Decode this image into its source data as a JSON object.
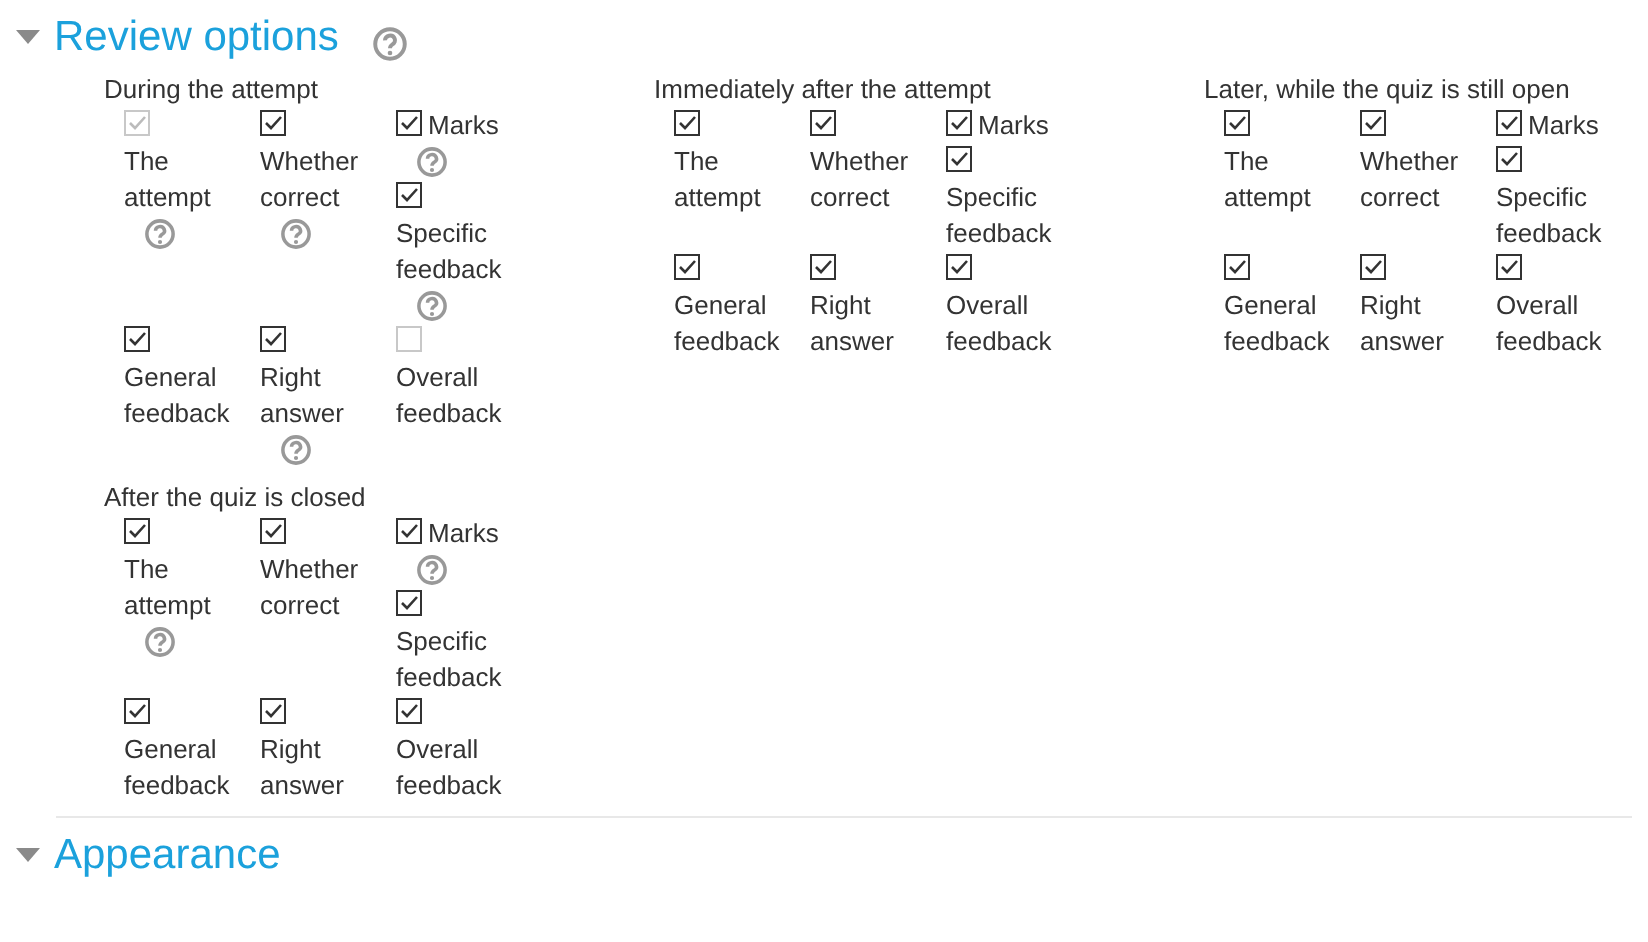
{
  "sections": [
    {
      "title": "Review options",
      "expanded": true,
      "help": true,
      "groups": [
        {
          "title": "During the attempt",
          "items": [
            {
              "label": "The attempt",
              "checked": true,
              "disabled": true,
              "help": true
            },
            {
              "label": "Whether correct",
              "checked": true,
              "disabled": false,
              "help": true
            },
            {
              "label": "Marks",
              "checked": true,
              "disabled": false,
              "help": true
            },
            {
              "label": "Specific feedback",
              "checked": true,
              "disabled": false,
              "help": true
            },
            {
              "label": "General feedback",
              "checked": true,
              "disabled": false,
              "help": false
            },
            {
              "label": "Right answer",
              "checked": true,
              "disabled": false,
              "help": true
            },
            {
              "label": "Overall feedback",
              "checked": false,
              "disabled": true,
              "help": false
            }
          ]
        },
        {
          "title": "Immediately after the attempt",
          "items": [
            {
              "label": "The attempt",
              "checked": true,
              "disabled": false,
              "help": false
            },
            {
              "label": "Whether correct",
              "checked": true,
              "disabled": false,
              "help": false
            },
            {
              "label": "Marks",
              "checked": true,
              "disabled": false,
              "help": false
            },
            {
              "label": "Specific feedback",
              "checked": true,
              "disabled": false,
              "help": false
            },
            {
              "label": "General feedback",
              "checked": true,
              "disabled": false,
              "help": false
            },
            {
              "label": "Right answer",
              "checked": true,
              "disabled": false,
              "help": false
            },
            {
              "label": "Overall feedback",
              "checked": true,
              "disabled": false,
              "help": false
            }
          ]
        },
        {
          "title": "Later, while the quiz is still open",
          "items": [
            {
              "label": "The attempt",
              "checked": true,
              "disabled": false,
              "help": false
            },
            {
              "label": "Whether correct",
              "checked": true,
              "disabled": false,
              "help": false
            },
            {
              "label": "Marks",
              "checked": true,
              "disabled": false,
              "help": false
            },
            {
              "label": "Specific feedback",
              "checked": true,
              "disabled": false,
              "help": false
            },
            {
              "label": "General feedback",
              "checked": true,
              "disabled": false,
              "help": false
            },
            {
              "label": "Right answer",
              "checked": true,
              "disabled": false,
              "help": false
            },
            {
              "label": "Overall feedback",
              "checked": true,
              "disabled": false,
              "help": false
            }
          ]
        },
        {
          "title": "After the quiz is closed",
          "items": [
            {
              "label": "The attempt",
              "checked": true,
              "disabled": false,
              "help": true
            },
            {
              "label": "Whether correct",
              "checked": true,
              "disabled": false,
              "help": false
            },
            {
              "label": "Marks",
              "checked": true,
              "disabled": false,
              "help": true
            },
            {
              "label": "Specific feedback",
              "checked": true,
              "disabled": false,
              "help": false
            },
            {
              "label": "General feedback",
              "checked": true,
              "disabled": false,
              "help": false
            },
            {
              "label": "Right answer",
              "checked": true,
              "disabled": false,
              "help": false
            },
            {
              "label": "Overall feedback",
              "checked": true,
              "disabled": false,
              "help": false
            }
          ]
        }
      ]
    },
    {
      "title": "Appearance",
      "expanded": true,
      "help": false
    }
  ]
}
